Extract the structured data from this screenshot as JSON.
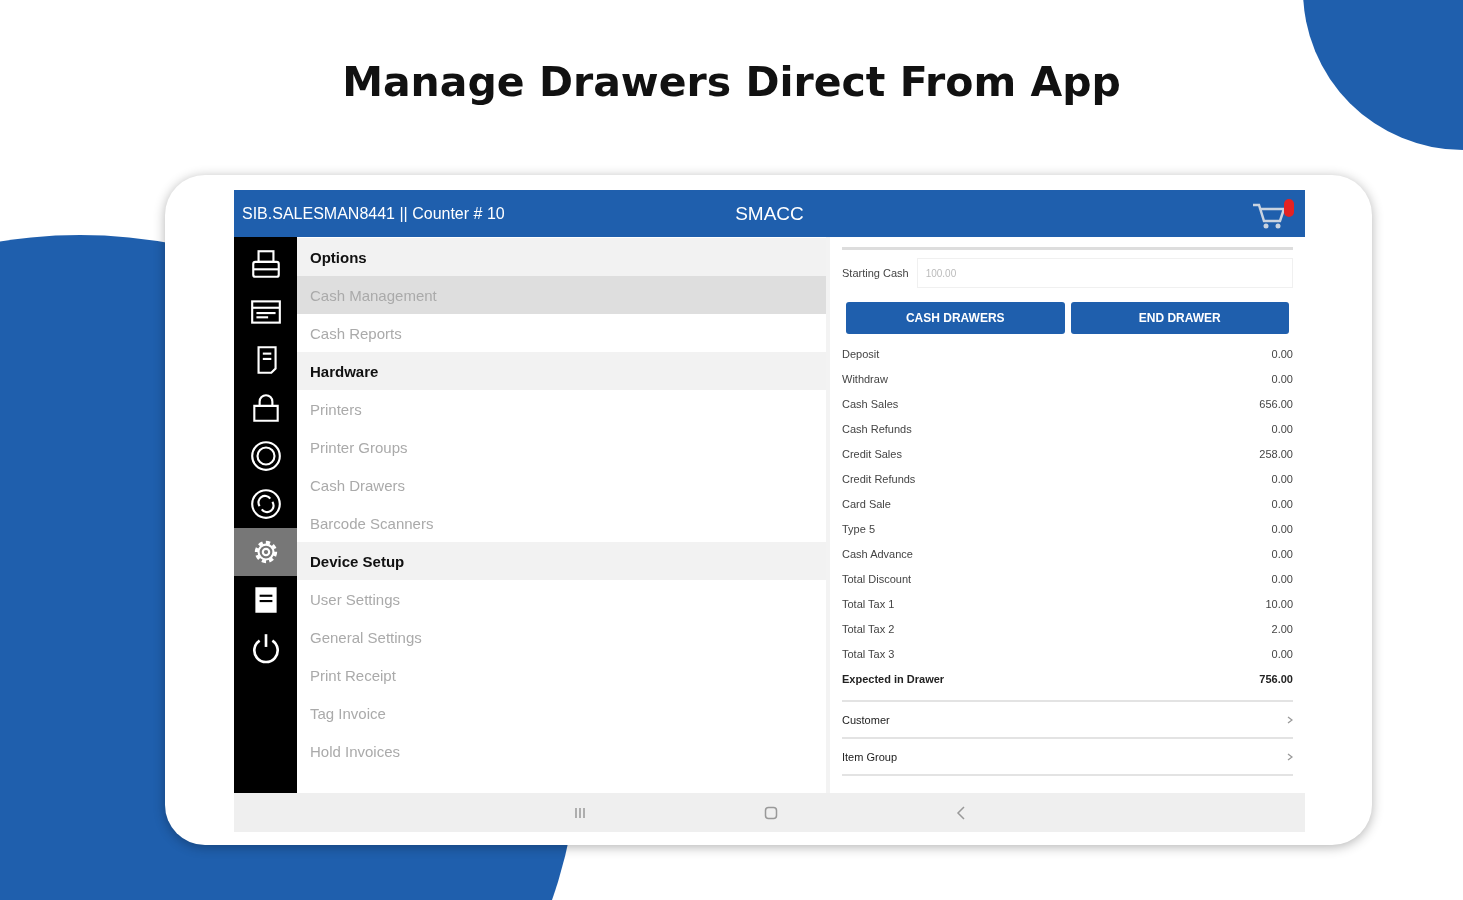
{
  "headline": "Manage Drawers Direct From App",
  "header": {
    "user": "SIB.SALESMAN8441 || Counter  # 10",
    "title": "SMACC"
  },
  "sidebar": {
    "items": [
      {
        "selected": false
      },
      {
        "selected": false
      },
      {
        "selected": false
      },
      {
        "selected": false
      },
      {
        "selected": false
      },
      {
        "selected": false
      },
      {
        "selected": true
      },
      {
        "selected": false
      },
      {
        "selected": false
      }
    ]
  },
  "menu": [
    {
      "kind": "header",
      "label": "Options",
      "selected": false
    },
    {
      "kind": "item",
      "label": "Cash Management",
      "selected": true
    },
    {
      "kind": "item",
      "label": "Cash Reports",
      "selected": false
    },
    {
      "kind": "header",
      "label": "Hardware",
      "selected": false
    },
    {
      "kind": "item",
      "label": "Printers",
      "selected": false
    },
    {
      "kind": "item",
      "label": "Printer Groups",
      "selected": false
    },
    {
      "kind": "item",
      "label": "Cash Drawers",
      "selected": false
    },
    {
      "kind": "item",
      "label": "Barcode Scanners",
      "selected": false
    },
    {
      "kind": "header",
      "label": "Device Setup",
      "selected": false
    },
    {
      "kind": "item",
      "label": "User Settings",
      "selected": false
    },
    {
      "kind": "item",
      "label": "General Settings",
      "selected": false
    },
    {
      "kind": "item",
      "label": "Print Receipt",
      "selected": false
    },
    {
      "kind": "item",
      "label": "Tag Invoice",
      "selected": false
    },
    {
      "kind": "item",
      "label": "Hold Invoices",
      "selected": false
    }
  ],
  "cash": {
    "starting_label": "Starting Cash",
    "starting_value": "100.00",
    "buttons": [
      "CASH DRAWERS",
      "END DRAWER"
    ],
    "rows": [
      {
        "label": "Deposit",
        "value": "0.00",
        "bold": false
      },
      {
        "label": "Withdraw",
        "value": "0.00",
        "bold": false
      },
      {
        "label": "Cash Sales",
        "value": "656.00",
        "bold": false
      },
      {
        "label": "Cash Refunds",
        "value": "0.00",
        "bold": false
      },
      {
        "label": "Credit Sales",
        "value": "258.00",
        "bold": false
      },
      {
        "label": "Credit Refunds",
        "value": "0.00",
        "bold": false
      },
      {
        "label": "Card Sale",
        "value": "0.00",
        "bold": false
      },
      {
        "label": "Type 5",
        "value": "0.00",
        "bold": false
      },
      {
        "label": "Cash Advance",
        "value": "0.00",
        "bold": false
      },
      {
        "label": "Total Discount",
        "value": "0.00",
        "bold": false
      },
      {
        "label": "Total Tax 1",
        "value": "10.00",
        "bold": false
      },
      {
        "label": "Total Tax 2",
        "value": "2.00",
        "bold": false
      },
      {
        "label": "Total Tax 3",
        "value": "0.00",
        "bold": false
      },
      {
        "label": "Expected in Drawer",
        "value": "756.00",
        "bold": true
      }
    ],
    "links": [
      "Customer",
      "Item Group"
    ]
  }
}
